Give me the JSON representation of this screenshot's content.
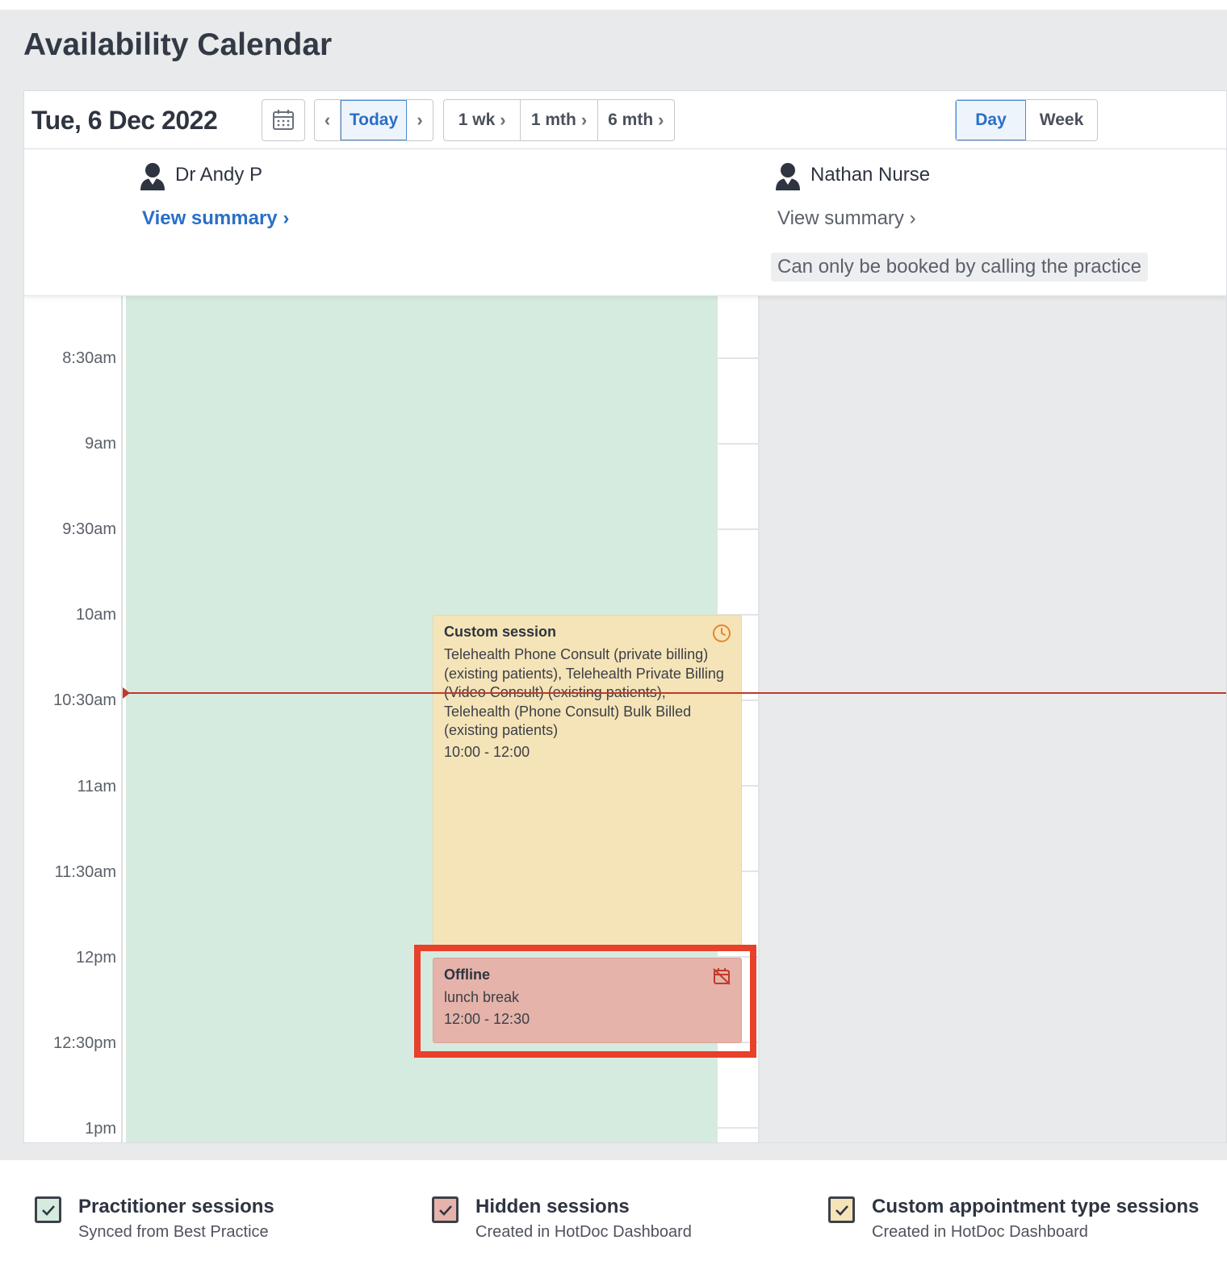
{
  "page": {
    "title": "Availability Calendar"
  },
  "toolbar": {
    "date": "Tue, 6 Dec 2022",
    "calendar_icon": "calendar-icon",
    "today_label": "Today",
    "ranges": [
      {
        "label": "1 wk"
      },
      {
        "label": "1 mth"
      },
      {
        "label": "6 mth"
      }
    ],
    "views": [
      {
        "label": "Day",
        "active": true
      },
      {
        "label": "Week",
        "active": false
      }
    ]
  },
  "practitioners": [
    {
      "name": "Dr Andy P",
      "summary_label": "View summary",
      "summary_color": "#2a6fc7",
      "avatar_icon": "avatar-icon"
    },
    {
      "name": "Nathan Nurse",
      "summary_label": "View summary",
      "summary_color": "#5b6069",
      "avatar_icon": "avatar-icon",
      "note": "Can only be booked by calling the practice"
    }
  ],
  "times": [
    "8:30am",
    "9am",
    "9:30am",
    "10am",
    "10:30am",
    "11am",
    "11:30am",
    "12pm",
    "12:30pm",
    "1pm"
  ],
  "events": {
    "custom": {
      "title": "Custom session",
      "description": "Telehealth Phone Consult (private billing) (existing patients), Telehealth Private Billing (Video Consult) (existing patients), Telehealth (Phone Consult) Bulk Billed (existing patients)",
      "time": "10:00 - 12:00",
      "icon": "clock-icon",
      "color": "#f5e4b8"
    },
    "offline": {
      "title": "Offline",
      "description": "lunch break",
      "time": "12:00 - 12:30",
      "icon": "calendar-off-icon",
      "color": "#e5b3aa"
    }
  },
  "legend": [
    {
      "title": "Practitioner sessions",
      "subtitle": "Synced from Best Practice",
      "color": "#d6ebe0"
    },
    {
      "title": "Hidden sessions",
      "subtitle": "Created in HotDoc Dashboard",
      "color": "#e5b3aa"
    },
    {
      "title": "Custom appointment type sessions",
      "subtitle": "Created in HotDoc Dashboard",
      "color": "#f5e4b8"
    }
  ],
  "colors": {
    "accent": "#2a6fc7",
    "now_line": "#c0392b",
    "highlight": "#e8402a",
    "practitioner_session": "#d6ebe0"
  }
}
